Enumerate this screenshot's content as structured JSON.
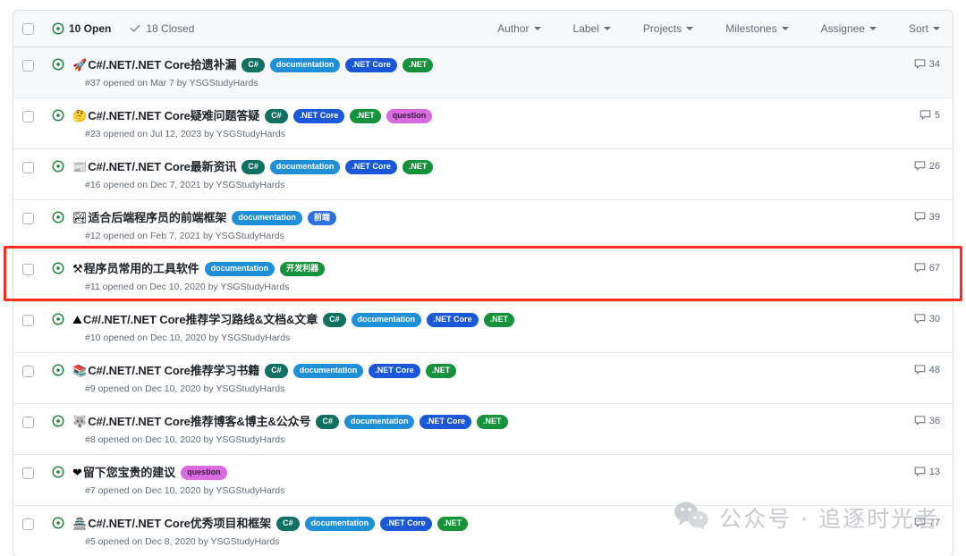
{
  "header": {
    "checkbox_name": "select-all-checkbox",
    "open_count_label": "10 Open",
    "closed_count_label": "18 Closed",
    "filters": [
      {
        "label": "Author"
      },
      {
        "label": "Label"
      },
      {
        "label": "Projects"
      },
      {
        "label": "Milestones"
      },
      {
        "label": "Assignee"
      },
      {
        "label": "Sort"
      }
    ]
  },
  "label_colors": {
    "csharp": {
      "bg": "#107161",
      "fg": "#ffffff"
    },
    "documentation": {
      "bg": "#1f8fd8",
      "fg": "#ffffff"
    },
    "dotnet_core": {
      "bg": "#1a58d8",
      "fg": "#ffffff"
    },
    "dotnet": {
      "bg": "#16933a",
      "fg": "#ffffff"
    },
    "question": {
      "bg": "#d96ae0",
      "fg": "#3b2040"
    },
    "frontend": {
      "bg": "#2f6fe0",
      "fg": "#ffffff"
    },
    "devtools": {
      "bg": "#16933a",
      "fg": "#ffffff"
    }
  },
  "issues": [
    {
      "emoji": "🚀",
      "title": "C#/.NET/.NET Core拾遗补漏",
      "labels": [
        {
          "text": "C#",
          "color": "csharp"
        },
        {
          "text": "documentation",
          "color": "documentation"
        },
        {
          "text": ".NET Core",
          "color": "dotnet_core"
        },
        {
          "text": ".NET",
          "color": "dotnet"
        }
      ],
      "meta": "#37 opened on Mar 7 by YSGStudyHards",
      "comments": "34",
      "shaded": true,
      "highlighted": false
    },
    {
      "emoji": "🤔",
      "title": "C#/.NET/.NET Core疑难问题答疑",
      "labels": [
        {
          "text": "C#",
          "color": "csharp"
        },
        {
          "text": ".NET Core",
          "color": "dotnet_core"
        },
        {
          "text": ".NET",
          "color": "dotnet"
        },
        {
          "text": "question",
          "color": "question"
        }
      ],
      "meta": "#23 opened on Jul 12, 2023 by YSGStudyHards",
      "comments": "5",
      "shaded": false,
      "highlighted": false
    },
    {
      "emoji": "📰",
      "title": "C#/.NET/.NET Core最新资讯",
      "labels": [
        {
          "text": "C#",
          "color": "csharp"
        },
        {
          "text": "documentation",
          "color": "documentation"
        },
        {
          "text": ".NET Core",
          "color": "dotnet_core"
        },
        {
          "text": ".NET",
          "color": "dotnet"
        }
      ],
      "meta": "#16 opened on Dec 7, 2021 by YSGStudyHards",
      "comments": "26",
      "shaded": false,
      "highlighted": false
    },
    {
      "emoji": "🏞",
      "title": "适合后端程序员的前端框架",
      "labels": [
        {
          "text": "documentation",
          "color": "documentation"
        },
        {
          "text": "前端",
          "color": "frontend"
        }
      ],
      "meta": "#12 opened on Feb 7, 2021 by YSGStudyHards",
      "comments": "39",
      "shaded": false,
      "highlighted": false
    },
    {
      "emoji": "⚒",
      "title": "程序员常用的工具软件",
      "labels": [
        {
          "text": "documentation",
          "color": "documentation"
        },
        {
          "text": "开发利器",
          "color": "devtools"
        }
      ],
      "meta": "#11 opened on Dec 10, 2020 by YSGStudyHards",
      "comments": "67",
      "shaded": false,
      "highlighted": true
    },
    {
      "emoji": "⛰",
      "title": "C#/.NET/.NET Core推荐学习路线&文档&文章",
      "labels": [
        {
          "text": "C#",
          "color": "csharp"
        },
        {
          "text": "documentation",
          "color": "documentation"
        },
        {
          "text": ".NET Core",
          "color": "dotnet_core"
        },
        {
          "text": ".NET",
          "color": "dotnet"
        }
      ],
      "meta": "#10 opened on Dec 10, 2020 by YSGStudyHards",
      "comments": "30",
      "shaded": false,
      "highlighted": false
    },
    {
      "emoji": "📚",
      "title": "C#/.NET/.NET Core推荐学习书籍",
      "labels": [
        {
          "text": "C#",
          "color": "csharp"
        },
        {
          "text": "documentation",
          "color": "documentation"
        },
        {
          "text": ".NET Core",
          "color": "dotnet_core"
        },
        {
          "text": ".NET",
          "color": "dotnet"
        }
      ],
      "meta": "#9 opened on Dec 10, 2020 by YSGStudyHards",
      "comments": "48",
      "shaded": false,
      "highlighted": false
    },
    {
      "emoji": "🐺",
      "title": "C#/.NET/.NET Core推荐博客&博主&公众号",
      "labels": [
        {
          "text": "C#",
          "color": "csharp"
        },
        {
          "text": "documentation",
          "color": "documentation"
        },
        {
          "text": ".NET Core",
          "color": "dotnet_core"
        },
        {
          "text": ".NET",
          "color": "dotnet"
        }
      ],
      "meta": "#8 opened on Dec 10, 2020 by YSGStudyHards",
      "comments": "36",
      "shaded": false,
      "highlighted": false
    },
    {
      "emoji": "❤",
      "title": "留下您宝贵的建议",
      "labels": [
        {
          "text": "question",
          "color": "question"
        }
      ],
      "meta": "#7 opened on Dec 10, 2020 by YSGStudyHards",
      "comments": "13",
      "shaded": false,
      "highlighted": false
    },
    {
      "emoji": "🏯",
      "title": "C#/.NET/.NET Core优秀项目和框架",
      "labels": [
        {
          "text": "C#",
          "color": "csharp"
        },
        {
          "text": "documentation",
          "color": "documentation"
        },
        {
          "text": ".NET Core",
          "color": "dotnet_core"
        },
        {
          "text": ".NET",
          "color": "dotnet"
        }
      ],
      "meta": "#5 opened on Dec 8, 2020 by YSGStudyHards",
      "comments": "77",
      "shaded": false,
      "highlighted": false
    }
  ],
  "watermark": {
    "text": "公众号 · 追逐时光者"
  }
}
